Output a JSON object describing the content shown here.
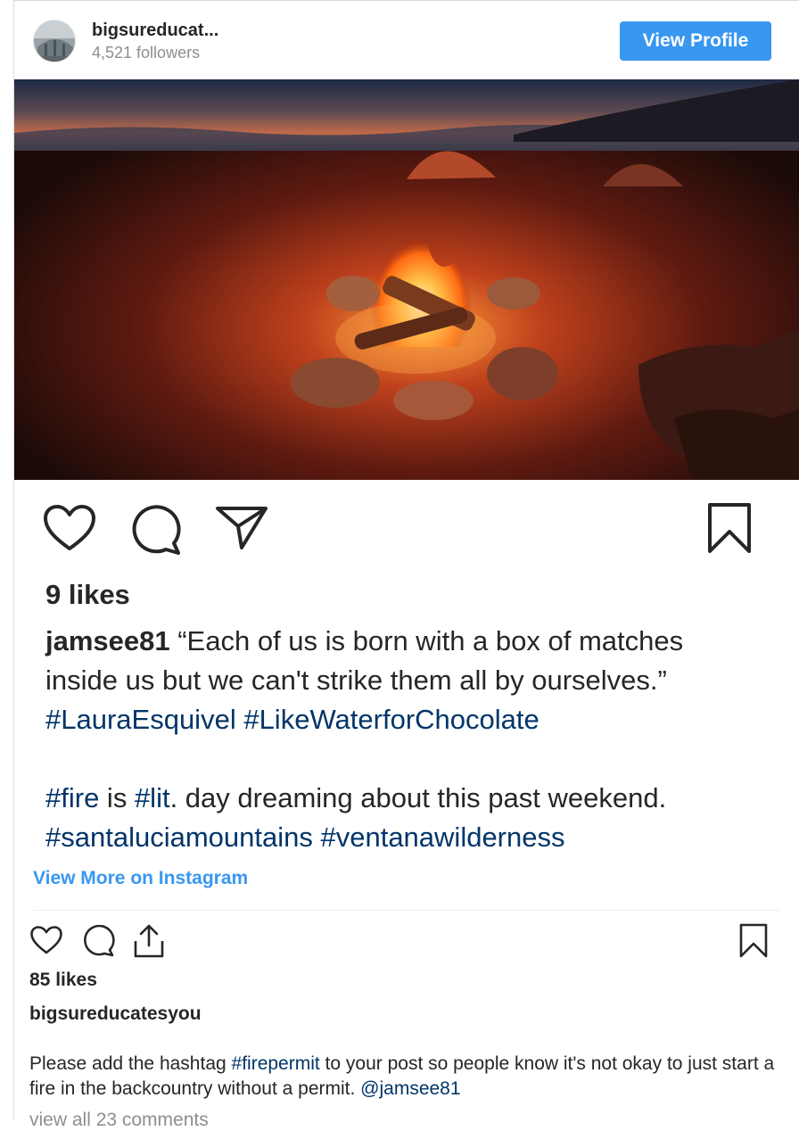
{
  "header": {
    "account_name": "bigsureducat...",
    "followers": "4,521 followers",
    "view_profile_label": "View Profile"
  },
  "photo": {
    "description_icon": "campfire-photo"
  },
  "embedded_post": {
    "likes": "9 likes",
    "caption_user": "jamsee81",
    "caption_line1": " “Each of us is born with a box of matches",
    "caption_line2": "inside us but we can't strike them all by ourselves.”",
    "hashtag_1": "#LauraEsquivel",
    "hashtag_2": "#LikeWaterforChocolate",
    "hashtag_fire": "#fire",
    "text_is": " is ",
    "hashtag_lit": "#lit",
    "text_daydream": ". day dreaming about this past weekend.",
    "hashtag_3": "#santaluciamountains",
    "hashtag_4": "#ventanawilderness"
  },
  "view_more_label": "View More on Instagram",
  "footer": {
    "likes": "85 likes",
    "owner": "bigsureducatesyou",
    "comment_part1": "Please add the hashtag ",
    "comment_tag": "#firepermit",
    "comment_part2": " to your post so people know it's not okay to just start a fire in the backcountry without a permit. ",
    "comment_mention": "@jamsee81",
    "view_all_comments": "view all 23 comments"
  },
  "colors": {
    "accent": "#3897f0",
    "hashtag": "#003569",
    "text": "#262626",
    "muted": "#8e8e8e"
  },
  "icons": [
    "heart-icon",
    "comment-icon",
    "share-icon",
    "bookmark-icon",
    "upload-icon"
  ]
}
